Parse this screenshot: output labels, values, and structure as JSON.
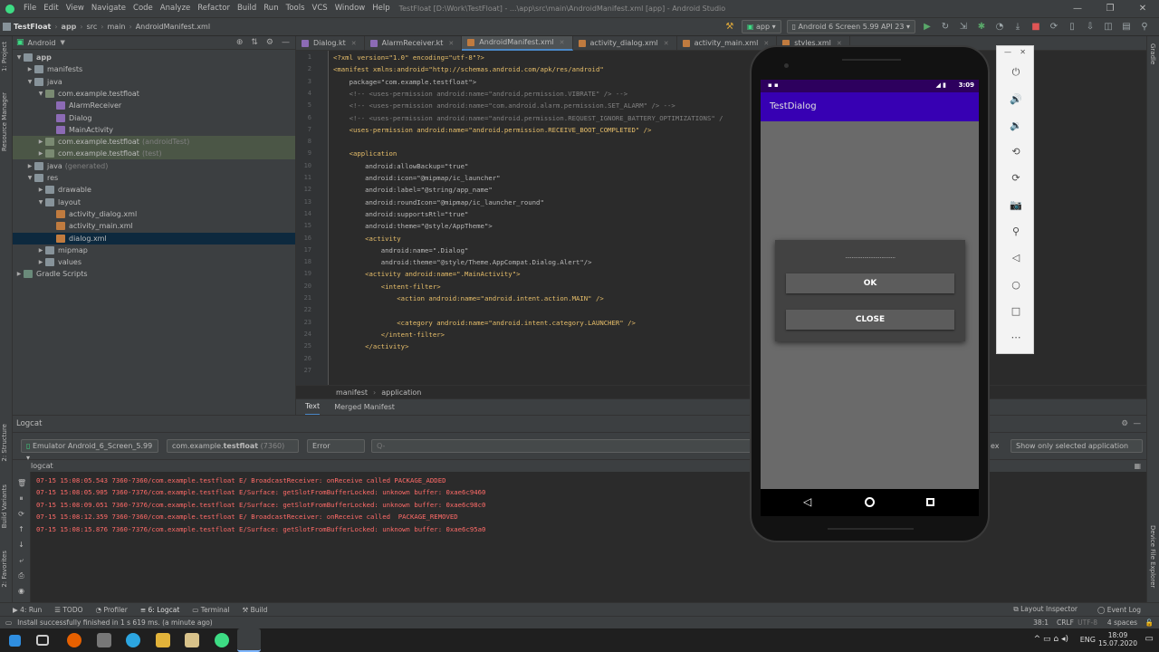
{
  "window": {
    "title": "TestFloat [D:\\Work\\TestFloat] - ...\\app\\src\\main\\AndroidManifest.xml [app] - Android Studio",
    "controls": [
      "—",
      "❐",
      "✕"
    ]
  },
  "menu": [
    "File",
    "Edit",
    "View",
    "Navigate",
    "Code",
    "Analyze",
    "Refactor",
    "Build",
    "Run",
    "Tools",
    "VCS",
    "Window",
    "Help"
  ],
  "navbar": {
    "breadcrumb": [
      "TestFloat",
      "app",
      "src",
      "main",
      "AndroidManifest.xml"
    ],
    "run_config": "app",
    "device": "Android 6 Screen 5.99 API 23"
  },
  "left_stripe": [
    "1: Project",
    "Resource Manager",
    "2: Structure",
    "Build Variants",
    "2: Favorites"
  ],
  "right_stripe": [
    "Gradle",
    "Device File Explorer"
  ],
  "project": {
    "view": "Android",
    "tree": [
      {
        "label": "app",
        "sub": "",
        "indent": 0,
        "arrow": "▼",
        "icon": "fold",
        "bold": true
      },
      {
        "label": "manifests",
        "sub": "",
        "indent": 1,
        "arrow": "▶",
        "icon": "fold"
      },
      {
        "label": "java",
        "sub": "",
        "indent": 1,
        "arrow": "▼",
        "icon": "fold"
      },
      {
        "label": "com.example.testfloat",
        "sub": "",
        "indent": 2,
        "arrow": "▼",
        "icon": "pkg"
      },
      {
        "label": "AlarmReceiver",
        "sub": "",
        "indent": 3,
        "arrow": "",
        "icon": "kt"
      },
      {
        "label": "Dialog",
        "sub": "",
        "indent": 3,
        "arrow": "",
        "icon": "kt"
      },
      {
        "label": "MainActivity",
        "sub": "",
        "indent": 3,
        "arrow": "",
        "icon": "kt"
      },
      {
        "label": "com.example.testfloat",
        "sub": "(androidTest)",
        "indent": 2,
        "arrow": "▶",
        "icon": "pkg",
        "hl": true
      },
      {
        "label": "com.example.testfloat",
        "sub": "(test)",
        "indent": 2,
        "arrow": "▶",
        "icon": "pkg",
        "hl": true
      },
      {
        "label": "java",
        "sub": "(generated)",
        "indent": 1,
        "arrow": "▶",
        "icon": "fold"
      },
      {
        "label": "res",
        "sub": "",
        "indent": 1,
        "arrow": "▼",
        "icon": "fold"
      },
      {
        "label": "drawable",
        "sub": "",
        "indent": 2,
        "arrow": "▶",
        "icon": "fold"
      },
      {
        "label": "layout",
        "sub": "",
        "indent": 2,
        "arrow": "▼",
        "icon": "fold"
      },
      {
        "label": "activity_dialog.xml",
        "sub": "",
        "indent": 3,
        "arrow": "",
        "icon": "xmlf"
      },
      {
        "label": "activity_main.xml",
        "sub": "",
        "indent": 3,
        "arrow": "",
        "icon": "xmlf"
      },
      {
        "label": "dialog.xml",
        "sub": "",
        "indent": 3,
        "arrow": "",
        "icon": "xmlf",
        "selected": true
      },
      {
        "label": "mipmap",
        "sub": "",
        "indent": 2,
        "arrow": "▶",
        "icon": "fold"
      },
      {
        "label": "values",
        "sub": "",
        "indent": 2,
        "arrow": "▶",
        "icon": "fold"
      },
      {
        "label": "Gradle Scripts",
        "sub": "",
        "indent": 0,
        "arrow": "▶",
        "icon": "grad"
      }
    ]
  },
  "tabs": [
    {
      "label": "Dialog.kt",
      "icon": "kt",
      "active": false
    },
    {
      "label": "AlarmReceiver.kt",
      "icon": "kt",
      "active": false
    },
    {
      "label": "AndroidManifest.xml",
      "icon": "xmlf",
      "active": true
    },
    {
      "label": "activity_dialog.xml",
      "icon": "xmlf",
      "active": false
    },
    {
      "label": "activity_main.xml",
      "icon": "xmlf",
      "active": false
    },
    {
      "label": "styles.xml",
      "icon": "xmlf",
      "active": false
    }
  ],
  "code": [
    "<?xml version=\"1.0\" encoding=\"utf-8\"?>",
    "<manifest xmlns:android=\"http://schemas.android.com/apk/res/android\"",
    "    package=\"com.example.testfloat\">",
    "    <!-- <uses-permission android:name=\"android.permission.VIBRATE\" /> -->",
    "    <!-- <uses-permission android:name=\"com.android.alarm.permission.SET_ALARM\" /> -->",
    "    <!-- <uses-permission android:name=\"android.permission.REQUEST_IGNORE_BATTERY_OPTIMIZATIONS\" /",
    "    <uses-permission android:name=\"android.permission.RECEIVE_BOOT_COMPLETED\" />",
    "",
    "    <application",
    "        android:allowBackup=\"true\"",
    "        android:icon=\"@mipmap/ic_launcher\"",
    "        android:label=\"@string/app_name\"",
    "        android:roundIcon=\"@mipmap/ic_launcher_round\"",
    "        android:supportsRtl=\"true\"",
    "        android:theme=\"@style/AppTheme\">",
    "        <activity",
    "            android:name=\".Dialog\"",
    "            android:theme=\"@style/Theme.AppCompat.Dialog.Alert\"/>",
    "        <activity android:name=\".MainActivity\">",
    "            <intent-filter>",
    "                <action android:name=\"android.intent.action.MAIN\" />",
    "",
    "                <category android:name=\"android.intent.category.LAUNCHER\" />",
    "            </intent-filter>",
    "        </activity>",
    "",
    ""
  ],
  "editor_breadcrumb": [
    "manifest",
    "application"
  ],
  "editor_bottom_tabs": [
    "Text",
    "Merged Manifest"
  ],
  "logcat": {
    "title": "Logcat",
    "device_combo": "Emulator Android_6_Screen_5.99",
    "process_combo_prefix": "com.example.",
    "process_combo_bold": "testfloat",
    "process_combo_pid": "(7360)",
    "level_combo": "Error",
    "search_placeholder": "Q-",
    "regex_label": "ex",
    "filter_combo": "Show only selected application",
    "sub_label": "logcat",
    "lines": [
      "07-15 15:08:05.543 7360-7360/com.example.testfloat E/ BroadcastReceiver: onReceive called PACKAGE_ADDED",
      "07-15 15:08:05.905 7360-7376/com.example.testfloat E/Surface: getSlotFromBufferLocked: unknown buffer: 0xae6c9460",
      "07-15 15:08:09.051 7360-7376/com.example.testfloat E/Surface: getSlotFromBufferLocked: unknown buffer: 0xae6c98c0",
      "07-15 15:08:12.359 7360-7360/com.example.testfloat E/ BroadcastReceiver: onReceive called  PACKAGE_REMOVED",
      "07-15 15:08:15.876 7360-7376/com.example.testfloat E/Surface: getSlotFromBufferLocked: unknown buffer: 0xae6c95a0"
    ]
  },
  "bottom_tools": [
    "4: Run",
    "TODO",
    "Profiler",
    "6: Logcat",
    "Terminal",
    "Build"
  ],
  "bottom_right": [
    "Layout Inspector",
    "Event Log"
  ],
  "status": {
    "message": "Install successfully finished in 1 s 619 ms. (a minute ago)",
    "position": "38:1",
    "line_sep": "CRLF",
    "encoding": "UTF-8",
    "indent": "4 spaces"
  },
  "taskbar": {
    "language": "ENG",
    "time": "18:09",
    "date": "15.07.2020"
  },
  "phone": {
    "time": "3:09",
    "app_title": "TestDialog",
    "dialog_text": "................................",
    "ok_label": "OK",
    "close_label": "CLOSE"
  },
  "colors": {
    "app_bar": "#3700b3",
    "status_bar": "#2d005e",
    "log_error": "#ff6b68",
    "accent": "#4a88c7"
  }
}
